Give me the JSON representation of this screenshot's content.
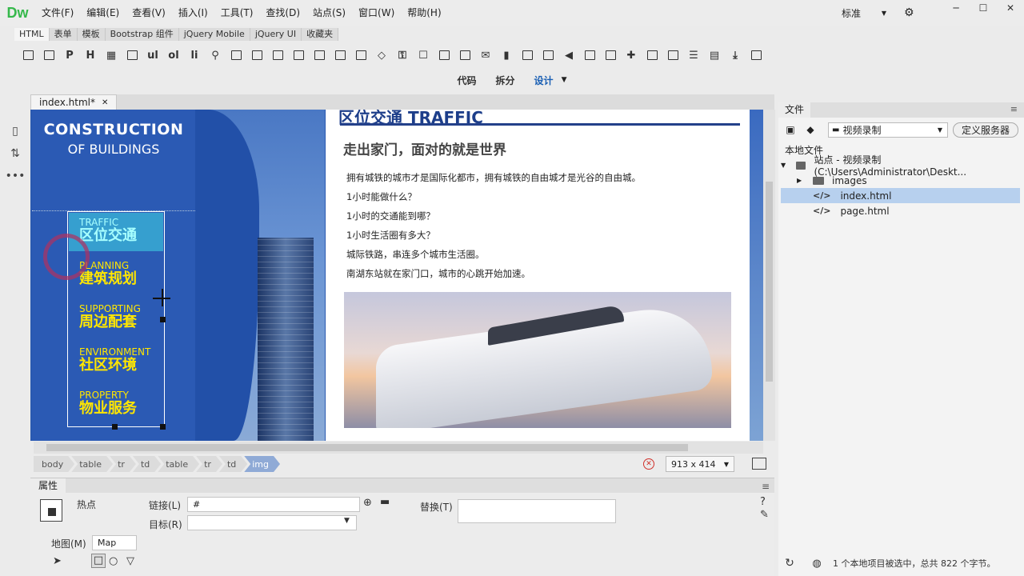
{
  "app": {
    "logo": "Dw"
  },
  "menu": [
    "文件(F)",
    "编辑(E)",
    "查看(V)",
    "插入(I)",
    "工具(T)",
    "查找(D)",
    "站点(S)",
    "窗口(W)",
    "帮助(H)"
  ],
  "layout": {
    "label": "标准"
  },
  "insert_tabs": [
    "HTML",
    "表单",
    "模板",
    "Bootstrap 组件",
    "jQuery Mobile",
    "jQuery UI",
    "收藏夹"
  ],
  "insert_text_buttons": {
    "ul": "ul",
    "ol": "ol",
    "li": "li"
  },
  "view_modes": [
    "代码",
    "拆分",
    "设计"
  ],
  "active_view": "设计",
  "document": {
    "tab": "index.html*"
  },
  "canvas": {
    "construction_title": "CONSTRUCTION",
    "construction_sub": "OF BUILDINGS",
    "nav": [
      {
        "en": "TRAFFIC",
        "zh": "区位交通"
      },
      {
        "en": "PLANNING",
        "zh": "建筑规划"
      },
      {
        "en": "SUPPORTING",
        "zh": "周边配套"
      },
      {
        "en": "ENVIRONMENT",
        "zh": "社区环境"
      },
      {
        "en": "PROPERTY",
        "zh": "物业服务"
      }
    ],
    "traffic_heading": "区位交通 TRAFFIC",
    "subheading": "走出家门，面对的就是世界",
    "paragraphs": [
      "拥有城铁的城市才是国际化都市，拥有城铁的自由城才是光谷的自由城。",
      "1小时能做什么？",
      "1小时的交通能到哪？",
      "1小时生活圈有多大？",
      "城际铁路，串连多个城市生活圈。",
      "南湖东站就在家门口，城市的心跳开始加速。"
    ]
  },
  "tag_selector": [
    "body",
    "table",
    "tr",
    "td",
    "table",
    "tr",
    "td",
    "img"
  ],
  "window_size": "913 x 414",
  "properties": {
    "title": "属性",
    "hotspot_label": "热点",
    "link_label": "链接(L)",
    "link_value": "#",
    "target_label": "目标(R)",
    "target_value": "",
    "alt_label": "替换(T)",
    "alt_value": "",
    "map_label": "地图(M)",
    "map_value": "Map"
  },
  "files_panel": {
    "tab": "文件",
    "site_select": "视频录制",
    "define_button": "定义服务器",
    "local_files": "本地文件",
    "tree": [
      {
        "name": "站点 - 视频录制 (C:\\Users\\Administrator\\Deskt...",
        "type": "site"
      },
      {
        "name": "images",
        "type": "folder"
      },
      {
        "name": "index.html",
        "type": "file",
        "selected": true
      },
      {
        "name": "page.html",
        "type": "file"
      }
    ],
    "status": "1 个本地项目被选中，总共 822 个字节。"
  }
}
